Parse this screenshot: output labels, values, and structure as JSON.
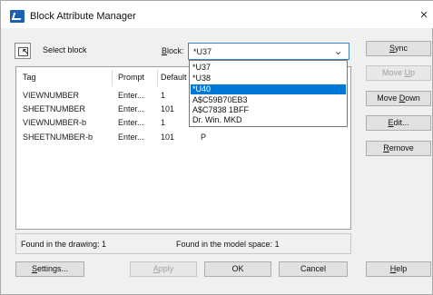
{
  "window": {
    "title": "Block Attribute Manager",
    "close": "×"
  },
  "select_block": {
    "label": "Select block"
  },
  "block": {
    "label": "Block:",
    "label_accel": "B",
    "label_rest": "lock:",
    "value": "*U37",
    "options": [
      "*U37",
      "*U38",
      "*U40",
      "A$C59B70EB3",
      "A$C7838 1BFF",
      "Dr. Win. MKD"
    ],
    "highlighted": "*U40"
  },
  "table": {
    "columns": [
      "Tag",
      "Prompt",
      "Default"
    ],
    "column_partial": "Default",
    "rows": [
      {
        "tag": "VIEWNUMBER",
        "prompt": "Enter...",
        "default": "1",
        "extra": ""
      },
      {
        "tag": "SHEETNUMBER",
        "prompt": "Enter...",
        "default": "101",
        "extra": ""
      },
      {
        "tag": "VIEWNUMBER-b",
        "prompt": "Enter...",
        "default": "1",
        "extra": ""
      },
      {
        "tag": "SHEETNUMBER-b",
        "prompt": "Enter...",
        "default": "101",
        "extra": "P"
      }
    ]
  },
  "side_buttons": {
    "sync": {
      "a": "S",
      "b": "ync"
    },
    "move_up": {
      "a": "Move ",
      "b": "U",
      "c": "p"
    },
    "move_down": {
      "a": "Move ",
      "b": "D",
      "c": "own"
    },
    "edit": {
      "a": "E",
      "b": "dit..."
    },
    "remove": {
      "a": "R",
      "b": "emove"
    }
  },
  "status": {
    "found_drawing": "Found in the drawing: 1",
    "found_model": "Found in the model space: 1"
  },
  "footer": {
    "settings": {
      "a": "S",
      "b": "ettings..."
    },
    "apply": {
      "a": "A",
      "b": "pply"
    },
    "ok": "OK",
    "cancel": "Cancel",
    "help": {
      "a": "H",
      "b": "elp"
    }
  },
  "colors": {
    "highlight": "#0078d7",
    "combo_border": "#3c7fd6"
  }
}
